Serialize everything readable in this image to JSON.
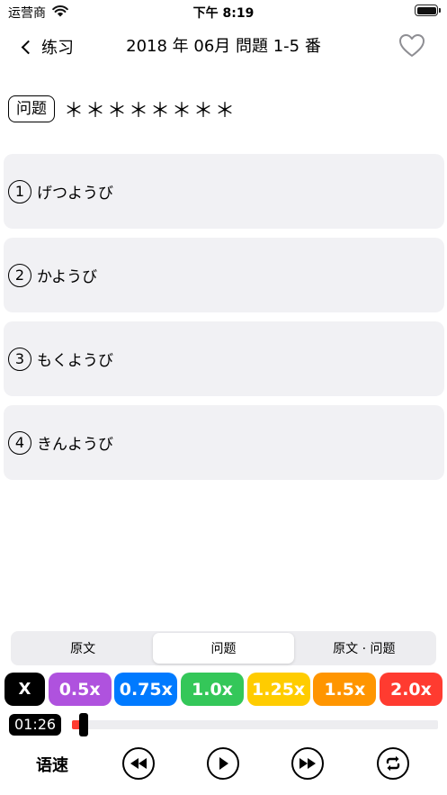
{
  "status": {
    "carrier": "运营商",
    "time": "下午 8:19"
  },
  "nav": {
    "back_label": "练习",
    "title": "2018 年 06月 問題 1-5 番"
  },
  "question": {
    "tag": "问题",
    "text": "＊＊＊＊＊＊＊＊"
  },
  "options": [
    {
      "num": "1",
      "text": "げつようび"
    },
    {
      "num": "2",
      "text": "かようび"
    },
    {
      "num": "3",
      "text": "もくようび"
    },
    {
      "num": "4",
      "text": "きんようび"
    }
  ],
  "tabs": {
    "original": "原文",
    "question": "问题",
    "both": "原文 · 问题",
    "active": "question"
  },
  "speeds": {
    "close": "X",
    "items": [
      {
        "label": "0.5x",
        "color": "#af52de"
      },
      {
        "label": "0.75x",
        "color": "#007aff"
      },
      {
        "label": "1.0x",
        "color": "#34c759"
      },
      {
        "label": "1.25x",
        "color": "#ffcc00"
      },
      {
        "label": "1.5x",
        "color": "#ff9500"
      },
      {
        "label": "2.0x",
        "color": "#ff3b30"
      }
    ]
  },
  "player": {
    "elapsed": "01:26",
    "progress_fraction": 0.02,
    "speed_label": "语速"
  },
  "colors": {
    "accent_red": "#ff3b30",
    "option_bg": "#f1f1f4"
  }
}
